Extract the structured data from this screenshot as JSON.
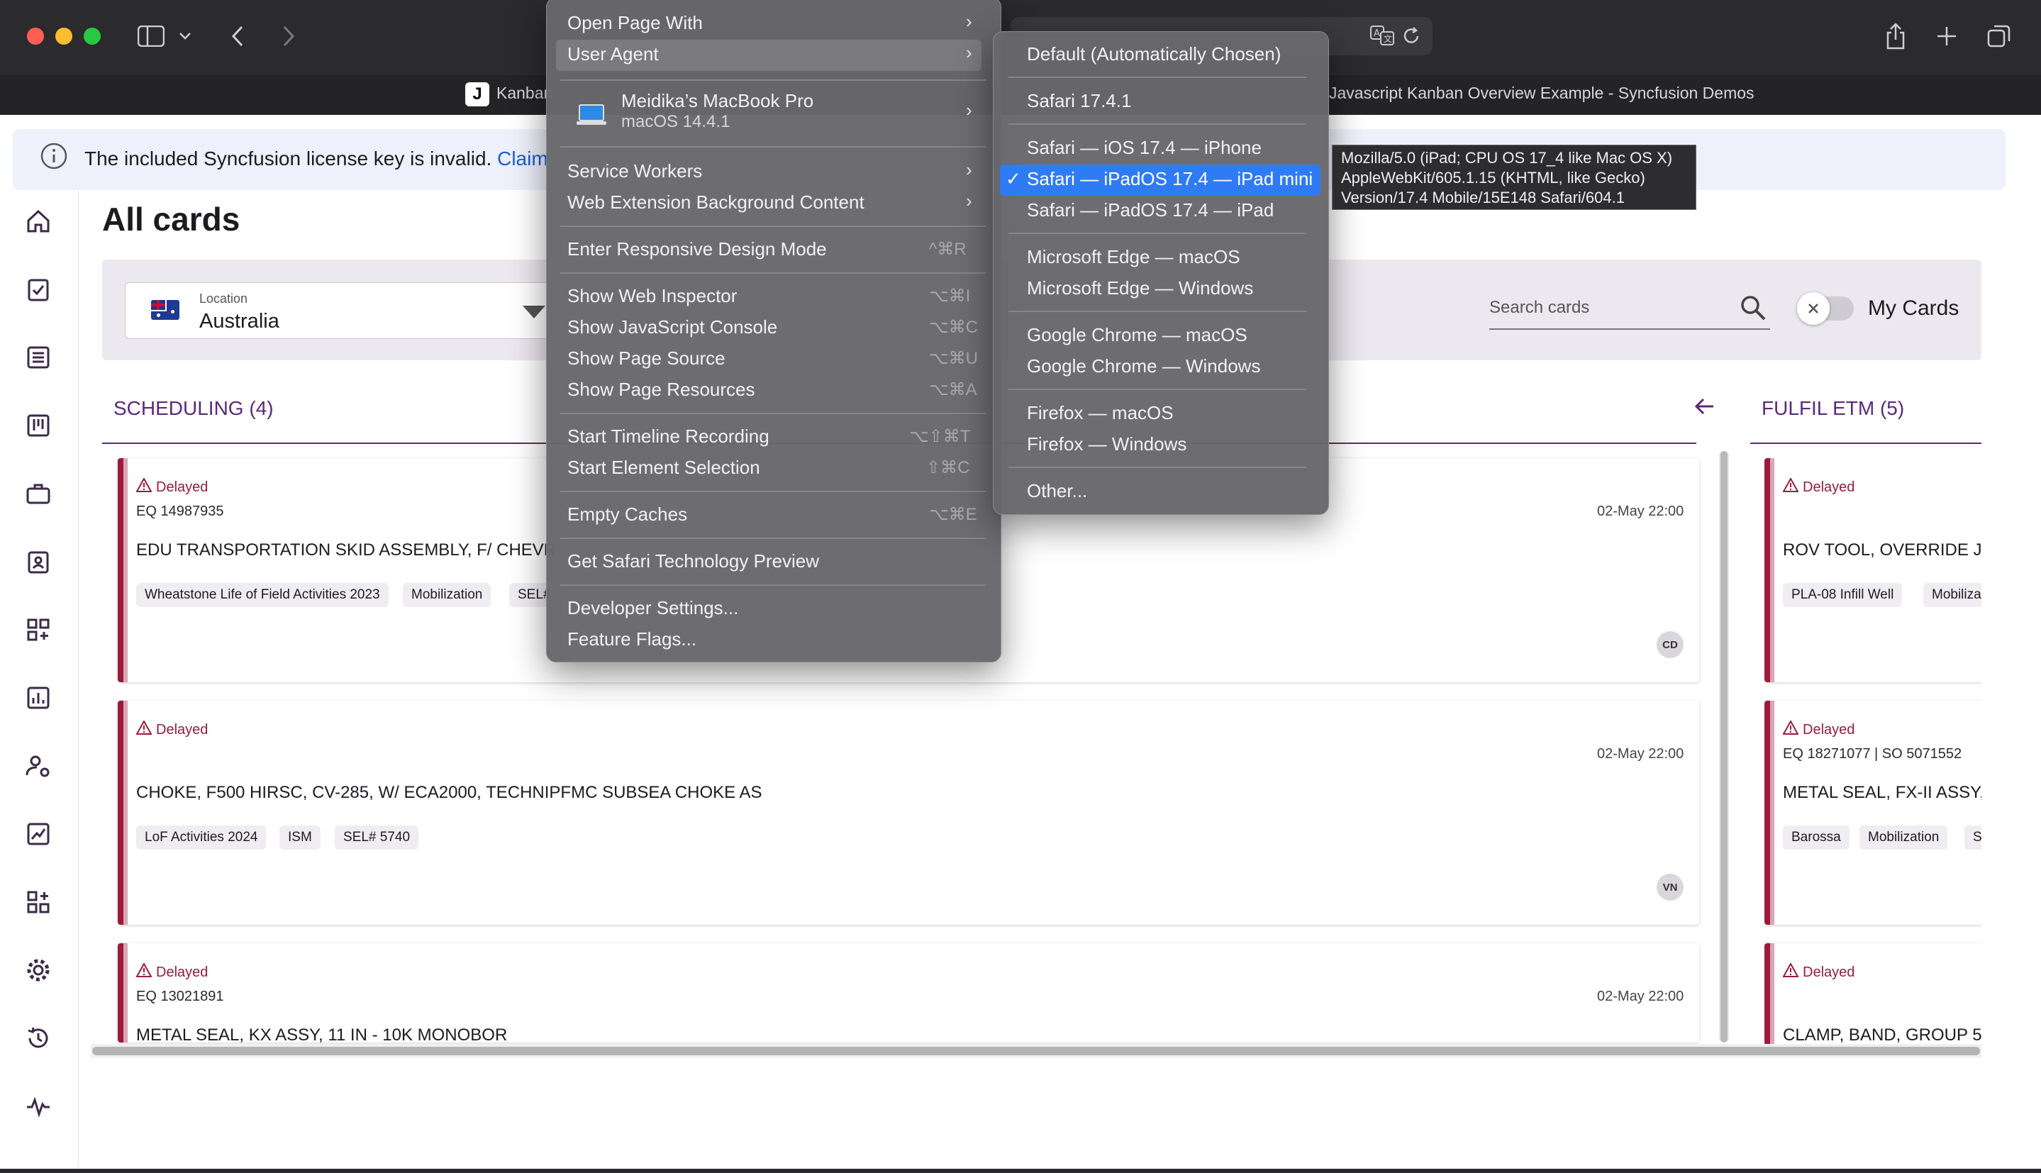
{
  "browser": {
    "tab_left": "Kanban",
    "tab_right": "Javascript Kanban Overview Example - Syncfusion Demos"
  },
  "banner": {
    "text": "The included Syncfusion license key is invalid.",
    "link": "Claim"
  },
  "page": {
    "title": "All cards",
    "location_label": "Location",
    "location_value": "Australia",
    "search_placeholder": "Search cards",
    "my_cards_label": "My Cards"
  },
  "columns": [
    {
      "header": "SCHEDULING (4)",
      "cards": [
        {
          "status": "Delayed",
          "eq": "EQ 14987935",
          "title": "EDU TRANSPORTATION SKID ASSEMBLY, F/ CHEVR",
          "tags": [
            "Wheatstone Life of Field Activities 2023",
            "Mobilization",
            "SEL#"
          ],
          "date": "02-May 22:00",
          "avatar": "CD"
        },
        {
          "status": "Delayed",
          "eq": "",
          "title": "CHOKE, F500 HIRSC, CV-285, W/ ECA2000, TECHNIPFMC SUBSEA CHOKE AS",
          "tags": [
            "LoF Activities 2024",
            "ISM",
            "SEL# 5740"
          ],
          "date": "02-May 22:00",
          "avatar": "VN"
        },
        {
          "status": "Delayed",
          "eq": "EQ 13021891",
          "title": "METAL SEAL, KX ASSY, 11 IN - 10K MONOBOR",
          "tags": [],
          "date": "02-May 22:00",
          "avatar": ""
        }
      ]
    },
    {
      "header": "FULFIL ETM (5)",
      "cards": [
        {
          "status": "Delayed",
          "eq": "",
          "title": "ROV TOOL, OVERRIDE JA",
          "tags": [
            "PLA-08 Infill Well",
            "Mobilizati"
          ]
        },
        {
          "status": "Delayed",
          "eq": "EQ 18271077 | SO 5071552",
          "title": "METAL SEAL, FX-II ASSY,",
          "tags": [
            "Barossa",
            "Mobilization",
            "SE"
          ]
        },
        {
          "status": "Delayed",
          "eq": "",
          "title": "CLAMP, BAND, GROUP 5,",
          "tags": []
        }
      ]
    }
  ],
  "develop_menu": {
    "open_page_with": "Open Page With",
    "user_agent": "User Agent",
    "device_name": "Meidika’s MacBook Pro",
    "device_os": "macOS 14.4.1",
    "service_workers": "Service Workers",
    "web_extension": "Web Extension Background Content",
    "responsive": "Enter Responsive Design Mode",
    "responsive_sc": "^⌘R",
    "inspector": "Show Web Inspector",
    "inspector_sc": "⌥⌘I",
    "console": "Show JavaScript Console",
    "console_sc": "⌥⌘C",
    "source": "Show Page Source",
    "source_sc": "⌥⌘U",
    "resources": "Show Page Resources",
    "resources_sc": "⌥⌘A",
    "timeline": "Start Timeline Recording",
    "timeline_sc": "⌥⇧⌘T",
    "element": "Start Element Selection",
    "element_sc": "⇧⌘C",
    "caches": "Empty Caches",
    "caches_sc": "⌥⌘E",
    "preview": "Get Safari Technology Preview",
    "settings": "Developer Settings...",
    "flags": "Feature Flags..."
  },
  "ua_menu": {
    "default": "Default (Automatically Chosen)",
    "safari": "Safari 17.4.1",
    "ios": "Safari — iOS 17.4 — iPhone",
    "ipad_mini": "Safari — iPadOS 17.4 — iPad mini",
    "ipad": "Safari — iPadOS 17.4 — iPad",
    "edge_mac": "Microsoft Edge — macOS",
    "edge_win": "Microsoft Edge — Windows",
    "chrome_mac": "Google Chrome — macOS",
    "chrome_win": "Google Chrome — Windows",
    "firefox_mac": "Firefox — macOS",
    "firefox_win": "Firefox — Windows",
    "other": "Other...",
    "checkmark": "✓"
  },
  "tooltip": {
    "line1": "Mozilla/5.0 (iPad; CPU OS 17_4 like Mac OS X)",
    "line2": "AppleWebKit/605.1.15 (KHTML, like Gecko)",
    "line3": "Version/17.4 Mobile/15E148 Safari/604.1"
  },
  "colors": {
    "accent": "#5b2a7a",
    "delayed": "#9b1b3a",
    "menu_highlight": "#2f7bf5"
  }
}
